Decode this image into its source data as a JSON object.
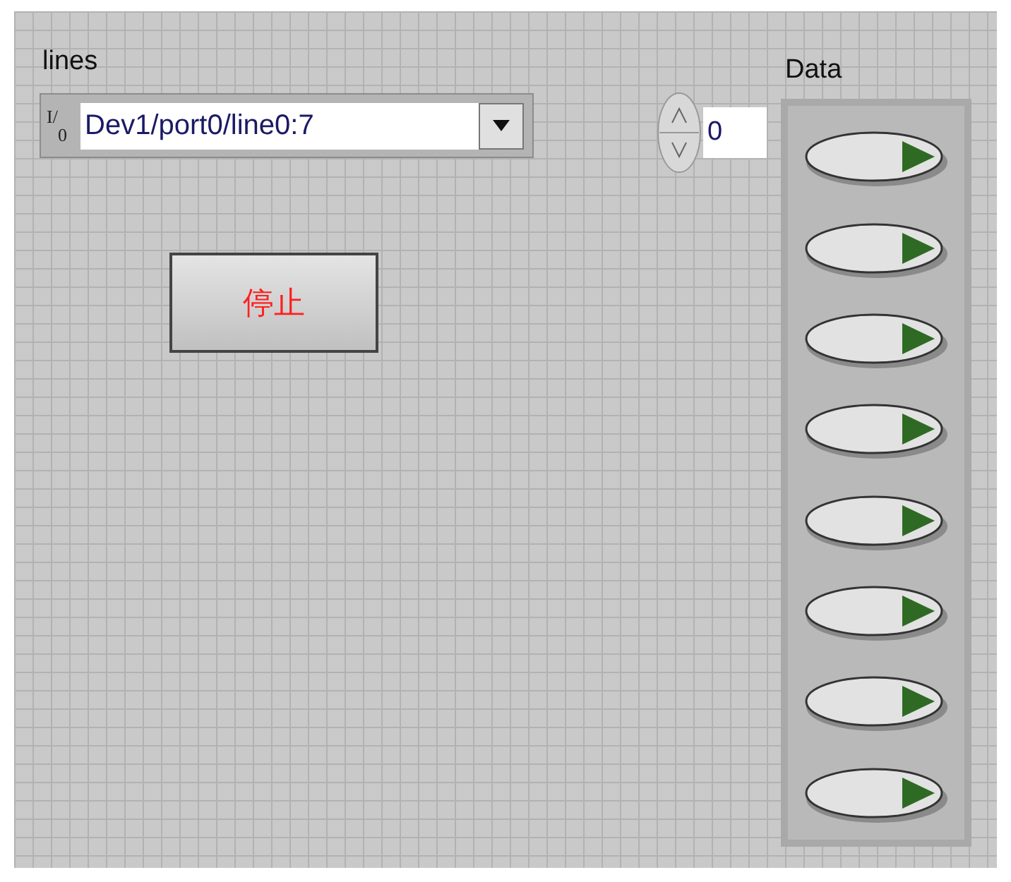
{
  "lines_control": {
    "label": "lines",
    "io_prefix": "I/0",
    "value": "Dev1/port0/line0:7"
  },
  "stop_button": {
    "label": "停止",
    "pressed": false
  },
  "data_array": {
    "label": "Data",
    "index": "0",
    "elements": [
      {
        "on": false
      },
      {
        "on": false
      },
      {
        "on": false
      },
      {
        "on": false
      },
      {
        "on": false
      },
      {
        "on": false
      },
      {
        "on": false
      },
      {
        "on": false
      }
    ]
  }
}
